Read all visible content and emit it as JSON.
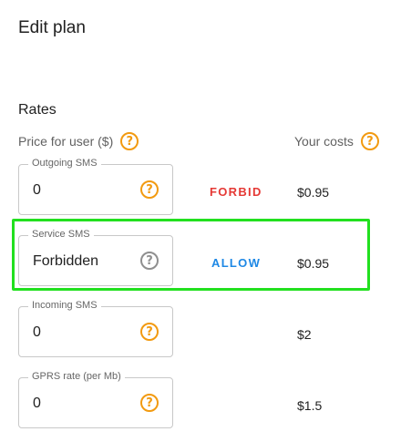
{
  "header": {
    "title": "Edit plan"
  },
  "rates": {
    "section_title": "Rates",
    "col_price": "Price for user ($)",
    "col_costs": "Your costs",
    "rows": [
      {
        "label": "Outgoing SMS",
        "value": "0",
        "action": "FORBID",
        "cost": "$0.95"
      },
      {
        "label": "Service SMS",
        "value": "Forbidden",
        "action": "ALLOW",
        "cost": "$0.95"
      },
      {
        "label": "Incoming SMS",
        "value": "0",
        "action": "",
        "cost": "$2"
      },
      {
        "label": "GPRS rate (per Mb)",
        "value": "0",
        "action": "",
        "cost": "$1.5"
      }
    ]
  },
  "icons": {
    "help": "help-circle-icon"
  },
  "colors": {
    "help_accent": "#f29a10",
    "help_disabled": "#8f8f8f",
    "forbid": "#e53935",
    "allow": "#1e88e5",
    "highlight": "#22e01f"
  }
}
